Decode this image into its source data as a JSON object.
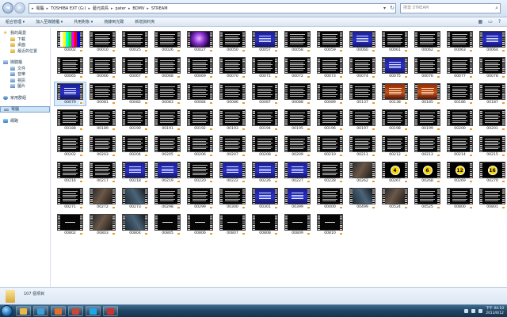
{
  "address": {
    "breadcrumbs": [
      "電腦",
      "TOSHIBA EXT (G:)",
      "藝元搞鳥",
      "pater",
      "BDMV",
      "STREAM"
    ],
    "search_placeholder": "搜尋 STREAM"
  },
  "toolbar": {
    "items": [
      "組合管理 ▾",
      "加入至媒體櫃 ▾",
      "共用對象 ▾",
      "燒錄到光碟",
      "新增資料夾"
    ]
  },
  "nav": {
    "favorites": "我的最愛",
    "favorites_items": [
      "下載",
      "桌面",
      "最近的位置"
    ],
    "libraries": "媒體櫃",
    "libraries_items": [
      "文件",
      "音樂",
      "視訊",
      "圖片"
    ],
    "homegroup": "家用群組",
    "computer": "電腦",
    "network": "網路"
  },
  "files": [
    {
      "name": "00002",
      "style": "bars"
    },
    {
      "name": "00010",
      "style": "text"
    },
    {
      "name": "00025",
      "style": "text"
    },
    {
      "name": "00026",
      "style": "text"
    },
    {
      "name": "00027",
      "style": "purple"
    },
    {
      "name": "00050",
      "style": "text"
    },
    {
      "name": "00057",
      "style": "blue"
    },
    {
      "name": "00058",
      "style": "text"
    },
    {
      "name": "00059",
      "style": "text"
    },
    {
      "name": "00060",
      "style": "blue"
    },
    {
      "name": "00061",
      "style": "text"
    },
    {
      "name": "00062",
      "style": "text"
    },
    {
      "name": "00063",
      "style": "text"
    },
    {
      "name": "00064",
      "style": "blue"
    },
    {
      "name": "00065",
      "style": "text"
    },
    {
      "name": "00066",
      "style": "text"
    },
    {
      "name": "00067",
      "style": "text"
    },
    {
      "name": "00068",
      "style": "text"
    },
    {
      "name": "00069",
      "style": "text"
    },
    {
      "name": "00070",
      "style": "text"
    },
    {
      "name": "00071",
      "style": "text"
    },
    {
      "name": "00072",
      "style": "text"
    },
    {
      "name": "00073",
      "style": "text"
    },
    {
      "name": "00074",
      "style": "text"
    },
    {
      "name": "00075",
      "style": "blue"
    },
    {
      "name": "00076",
      "style": "text"
    },
    {
      "name": "00077",
      "style": "text"
    },
    {
      "name": "00078",
      "style": "text"
    },
    {
      "name": "00079",
      "style": "blue",
      "selected": true
    },
    {
      "name": "00081",
      "style": "text"
    },
    {
      "name": "00082",
      "style": "text"
    },
    {
      "name": "00083",
      "style": "text"
    },
    {
      "name": "00084",
      "style": "text"
    },
    {
      "name": "00086",
      "style": "text"
    },
    {
      "name": "00087",
      "style": "text"
    },
    {
      "name": "00088",
      "style": "text"
    },
    {
      "name": "00089",
      "style": "text"
    },
    {
      "name": "00137",
      "style": "text"
    },
    {
      "name": "00138",
      "style": "orange"
    },
    {
      "name": "00185",
      "style": "orange"
    },
    {
      "name": "00186",
      "style": "text"
    },
    {
      "name": "00187",
      "style": "text"
    },
    {
      "name": "00188",
      "style": "text"
    },
    {
      "name": "00189",
      "style": "text"
    },
    {
      "name": "00190",
      "style": "text"
    },
    {
      "name": "00191",
      "style": "text"
    },
    {
      "name": "00192",
      "style": "text"
    },
    {
      "name": "00193",
      "style": "text"
    },
    {
      "name": "00194",
      "style": "text"
    },
    {
      "name": "00195",
      "style": "text"
    },
    {
      "name": "00196",
      "style": "text"
    },
    {
      "name": "00197",
      "style": "text"
    },
    {
      "name": "00198",
      "style": "text"
    },
    {
      "name": "00199",
      "style": "text"
    },
    {
      "name": "00200",
      "style": "text"
    },
    {
      "name": "00201",
      "style": "text"
    },
    {
      "name": "00202",
      "style": "text"
    },
    {
      "name": "00203",
      "style": "text"
    },
    {
      "name": "00204",
      "style": "text"
    },
    {
      "name": "00205",
      "style": "text"
    },
    {
      "name": "00206",
      "style": "text"
    },
    {
      "name": "00207",
      "style": "text"
    },
    {
      "name": "00208",
      "style": "text"
    },
    {
      "name": "00209",
      "style": "text"
    },
    {
      "name": "00210",
      "style": "text"
    },
    {
      "name": "00211",
      "style": "text"
    },
    {
      "name": "00212",
      "style": "text"
    },
    {
      "name": "00213",
      "style": "text"
    },
    {
      "name": "00214",
      "style": "text"
    },
    {
      "name": "00215",
      "style": "text"
    },
    {
      "name": "00216",
      "style": "text"
    },
    {
      "name": "00217",
      "style": "text"
    },
    {
      "name": "00218",
      "style": "blue"
    },
    {
      "name": "00219",
      "style": "blue"
    },
    {
      "name": "00220",
      "style": "text"
    },
    {
      "name": "00222",
      "style": "blue"
    },
    {
      "name": "00226",
      "style": "blue"
    },
    {
      "name": "00227",
      "style": "blue"
    },
    {
      "name": "00228",
      "style": "text"
    },
    {
      "name": "00262",
      "style": "photo"
    },
    {
      "name": "00267",
      "style": "num",
      "num": "4"
    },
    {
      "name": "00268",
      "style": "num",
      "num": "6"
    },
    {
      "name": "00269",
      "style": "num",
      "num": "12"
    },
    {
      "name": "00270",
      "style": "num",
      "num": "16"
    },
    {
      "name": "00271",
      "style": "text"
    },
    {
      "name": "00272",
      "style": "photo"
    },
    {
      "name": "00273",
      "style": "photo2"
    },
    {
      "name": "00298",
      "style": "text"
    },
    {
      "name": "00299",
      "style": "text"
    },
    {
      "name": "00300",
      "style": "text"
    },
    {
      "name": "00301",
      "style": "blue"
    },
    {
      "name": "00399",
      "style": "blue"
    },
    {
      "name": "00400",
      "style": "text"
    },
    {
      "name": "00499",
      "style": "photo2"
    },
    {
      "name": "00524",
      "style": "photo"
    },
    {
      "name": "00525",
      "style": "text"
    },
    {
      "name": "00800",
      "style": "text"
    },
    {
      "name": "00801",
      "style": "text"
    },
    {
      "name": "00802",
      "style": "dark"
    },
    {
      "name": "00803",
      "style": "photo"
    },
    {
      "name": "00804",
      "style": "photo2"
    },
    {
      "name": "00805",
      "style": "dark"
    },
    {
      "name": "00806",
      "style": "dark"
    },
    {
      "name": "00807",
      "style": "dark"
    },
    {
      "name": "00808",
      "style": "dark"
    },
    {
      "name": "00809",
      "style": "dark"
    },
    {
      "name": "00810",
      "style": "dark"
    }
  ],
  "status": {
    "item_count": "107 個項目"
  },
  "taskbar": {
    "apps": [
      {
        "name": "explorer",
        "color": "#e8b84a"
      },
      {
        "name": "media-player",
        "color": "#3aa0e0"
      },
      {
        "name": "firefox",
        "color": "#e3702a"
      },
      {
        "name": "photos",
        "color": "#c9463a"
      },
      {
        "name": "skype",
        "color": "#1ea7e8"
      },
      {
        "name": "game",
        "color": "#d03030"
      }
    ],
    "time": "下午 04:10",
    "date": "2013/6/12"
  }
}
